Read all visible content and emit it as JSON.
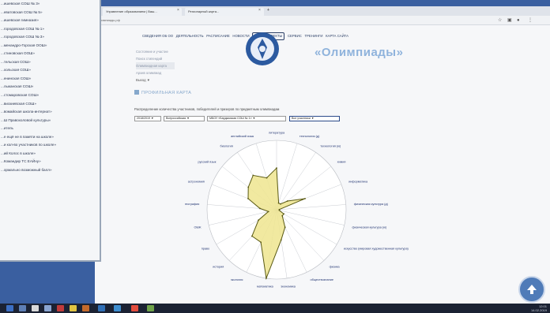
{
  "left_panel": {
    "items": [
      "...ишевская СОШ № 3»",
      "...еватовская СОШ № 5»",
      "...ишевская гимназия»",
      "...городовская СОШ № 1»",
      "...городовская СОШ № 3»",
      "...менандро-Горская ООШ»",
      "...стиновская ООШ»",
      "...тельская СОШ»",
      "...хольская СОШ»",
      "...енинская СОШ»",
      "...льжанская СОШ»",
      "...стомаровская СОШ»",
      "...вискиевская СОШ»",
      "...вомайская школа-интернат»",
      "...Ш Правохоловой культуры»",
      "...итель",
      "...е ещё не в памяти на школе»",
      "...и кол-во участников по школе»",
      "...ий Колос в школе»",
      "...Командир ТС ЕАЙну»",
      "...ормально возможный балл»"
    ]
  },
  "browser": {
    "tabs": [
      {
        "label": "Управление образованием | Ваш..."
      },
      {
        "label": "Регионарный карта..."
      }
    ],
    "url": "олимпиады.рф"
  },
  "site": {
    "nav": [
      "СВЕДЕНИЯ ОБ ОО",
      "ДЕЯТЕЛЬНОСТЬ",
      "РАСПИСАНИЕ",
      "НОВОСТИ",
      "НАШИ ПРОЕКТЫ",
      "СЕРВИС",
      "ТРЕНИНГИ",
      "КАРТА САЙТА"
    ],
    "nav_active_index": 4,
    "brand": "«Олимпиады»",
    "side_links": [
      "Состояние и участие",
      "Поиск стипендий",
      "Олимпиадная карта",
      "Архив олимпиад"
    ],
    "side_links_highlight_index": 2,
    "side_more": "Выход ▼",
    "section_title": "ПРОФИЛЬНАЯ КАРТА",
    "description": "Распределение количества участников, победителей и призеров по предметным олимпиадам",
    "filters": [
      "2018/2019 ▼",
      "Всероссийская ▼",
      "МБОУ «Бардымская СОШ № 1» ▼",
      "Все участники ▼"
    ]
  },
  "chart_data": {
    "type": "radar",
    "categories": [
      "литература",
      "технология (д)",
      "технология (ю)",
      "химия",
      "информатика",
      "физическая культура (д)",
      "физическая культура (ю)",
      "искусство (мировая художественная культура)",
      "физика",
      "обществознание",
      "экономика",
      "математика",
      "экология",
      "история",
      "право",
      "ОБЖ",
      "география",
      "астрономия",
      "русский язык",
      "биология",
      "английский язык"
    ],
    "values": [
      30,
      5,
      5,
      10,
      22,
      2,
      2,
      6,
      6,
      14,
      22,
      50,
      26,
      26,
      15,
      6,
      12,
      22,
      26,
      30,
      24
    ],
    "rmax": 50,
    "grid": true,
    "fill_color": "#efe58f",
    "line_color": "#5a5a14"
  },
  "taskbar": {
    "tray_time": "12:01",
    "tray_date": "14.02.2019"
  }
}
